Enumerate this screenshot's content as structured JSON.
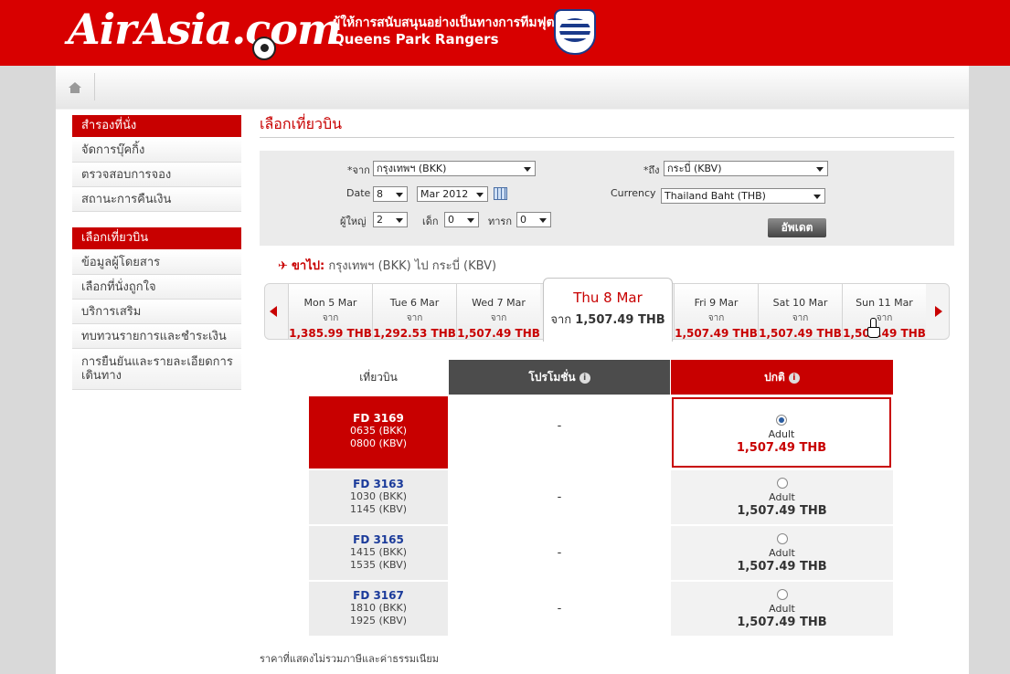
{
  "header": {
    "logo": "AirAsia.com",
    "sponsor_line1": "ผู้ให้การสนับสนุนอย่างเป็นทางการทีมฟุตบอล",
    "sponsor_line2": "Queens Park Rangers"
  },
  "sidebar": {
    "section1": {
      "header": "สำรองที่นั่ง",
      "items": [
        "จัดการบุ๊คกิ้ง",
        "ตรวจสอบการจอง",
        "สถานะการคืนเงิน"
      ]
    },
    "section2": {
      "header": "เลือกเที่ยวบิน",
      "items": [
        "ข้อมูลผู้โดยสาร",
        "เลือกที่นั่งถูกใจ",
        "บริการเสริม",
        "ทบทวนรายการและชำระเงิน",
        "การยืนยันและรายละเอียดการเดินทาง"
      ]
    }
  },
  "main": {
    "title": "เลือกเที่ยวบิน",
    "search": {
      "from_label": "*จาก",
      "from_value": "กรุงเทพฯ (BKK)",
      "to_label": "*ถึง",
      "to_value": "กระบี่ (KBV)",
      "date_label": "Date",
      "date_day": "8",
      "date_month": "Mar 2012",
      "currency_label": "Currency",
      "currency_value": "Thailand Baht (THB)",
      "adults_label": "ผู้ใหญ่",
      "adults_value": "2",
      "children_label": "เด็ก",
      "children_value": "0",
      "infants_label": "ทารก",
      "infants_value": "0",
      "update_button": "อัพเดต"
    },
    "route": {
      "direction": "ขาไป:",
      "from": "กรุงเทพฯ (BKK)",
      "to_word": "ไป",
      "to": "กระบี่ (KBV)"
    },
    "dates": [
      {
        "day": "Mon 5 Mar",
        "from": "จาก",
        "price": "1,385.99 THB"
      },
      {
        "day": "Tue 6 Mar",
        "from": "จาก",
        "price": "1,292.53 THB"
      },
      {
        "day": "Wed 7 Mar",
        "from": "จาก",
        "price": "1,507.49 THB"
      },
      {
        "day": "Thu 8 Mar",
        "from": "จาก",
        "price": "1,507.49 THB"
      },
      {
        "day": "Fri 9 Mar",
        "from": "จาก",
        "price": "1,507.49 THB"
      },
      {
        "day": "Sat 10 Mar",
        "from": "จาก",
        "price": "1,507.49 THB"
      },
      {
        "day": "Sun 11 Mar",
        "from": "จาก",
        "price": "1,507.49 THB"
      }
    ],
    "table": {
      "col_flight": "เที่ยวบิน",
      "col_promo": "โปรโมชั่น",
      "col_regular": "ปกติ",
      "rows": [
        {
          "flight": "FD 3169",
          "dep": "0635 (BKK)",
          "arr": "0800 (KBV)",
          "promo": "-",
          "pax": "Adult",
          "price": "1,507.49 THB"
        },
        {
          "flight": "FD 3163",
          "dep": "1030 (BKK)",
          "arr": "1145 (KBV)",
          "promo": "-",
          "pax": "Adult",
          "price": "1,507.49 THB"
        },
        {
          "flight": "FD 3165",
          "dep": "1415 (BKK)",
          "arr": "1535 (KBV)",
          "promo": "-",
          "pax": "Adult",
          "price": "1,507.49 THB"
        },
        {
          "flight": "FD 3167",
          "dep": "1810 (BKK)",
          "arr": "1925 (KBV)",
          "promo": "-",
          "pax": "Adult",
          "price": "1,507.49 THB"
        }
      ]
    },
    "note": "ราคาที่แสดงไม่รวมภาษีและค่าธรรมเนียม"
  },
  "colors": {
    "brand_red": "#c80000",
    "promo_header": "#4c4c4c",
    "flight_blue": "#1a3a9a"
  }
}
